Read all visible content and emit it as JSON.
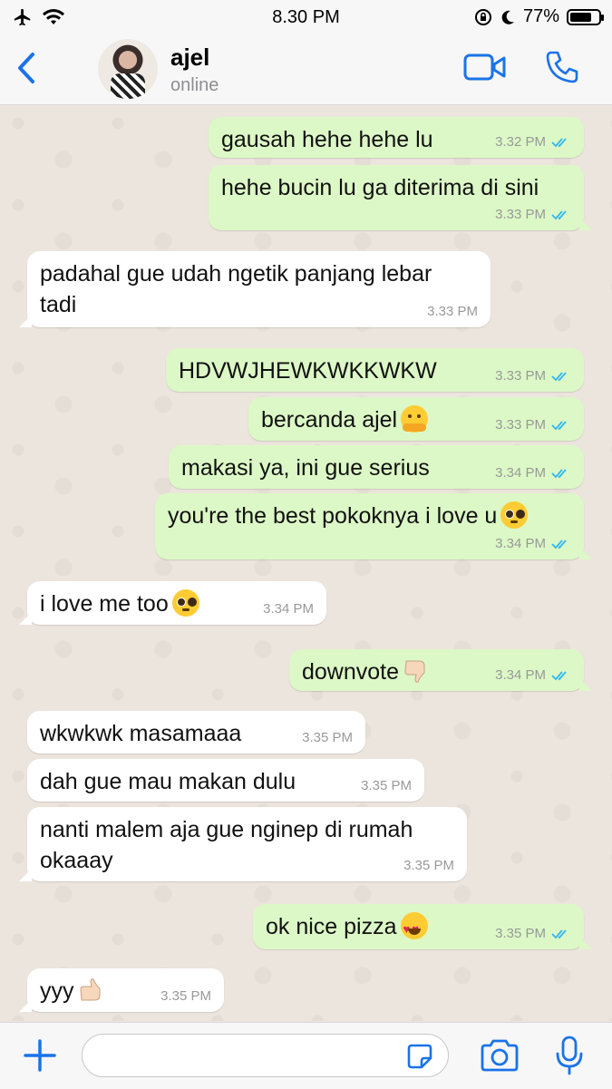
{
  "status_bar": {
    "time": "8.30 PM",
    "battery": "77%",
    "battery_level": 0.77,
    "icons": [
      "airplane-icon",
      "wifi-icon",
      "orientation-lock-icon",
      "moon-icon",
      "battery-icon"
    ]
  },
  "header": {
    "contact_name": "ajel",
    "status": "online",
    "accent": "#1a73e8"
  },
  "messages": [
    {
      "dir": "out",
      "text": "gausah hehe hehe lu",
      "time": "3.32 PM",
      "read": true
    },
    {
      "dir": "out",
      "text": "hehe bucin lu ga diterima di sini",
      "time": "3.33 PM",
      "read": true
    },
    {
      "dir": "in",
      "lines": [
        "padahal gue udah ngetik panjang lebar",
        "tadi"
      ],
      "time": "3.33 PM"
    },
    {
      "dir": "out",
      "text": "HDVWJHEWKWKKWKW",
      "time": "3.33 PM",
      "read": true
    },
    {
      "dir": "out",
      "text": "bercanda ajel",
      "emoji": "hugging-face-emoji",
      "time": "3.33 PM",
      "read": true
    },
    {
      "dir": "out",
      "text": "makasi ya, ini gue serius",
      "time": "3.34 PM",
      "read": true
    },
    {
      "dir": "out",
      "text": "you're the best pokoknya i love u",
      "emoji": "pleading-face-emoji",
      "time": "3.34 PM",
      "read": true
    },
    {
      "dir": "in",
      "text": "i love me too",
      "emoji": "pleading-face-emoji",
      "time": "3.34 PM"
    },
    {
      "dir": "out",
      "text": "downvote",
      "emoji": "thumbs-down-emoji",
      "time": "3.34 PM",
      "read": true
    },
    {
      "dir": "in",
      "text": "wkwkwk masamaaa",
      "time": "3.35 PM"
    },
    {
      "dir": "in",
      "text": "dah gue mau makan dulu",
      "time": "3.35 PM"
    },
    {
      "dir": "in",
      "lines": [
        "nanti malem aja gue nginep di rumah",
        "okaaay"
      ],
      "time": "3.35 PM"
    },
    {
      "dir": "out",
      "text": "ok nice pizza",
      "emoji": "heart-eyes-emoji",
      "time": "3.35 PM",
      "read": true
    },
    {
      "dir": "in",
      "text": "yyy",
      "emoji": "thumbs-up-emoji",
      "time": "3.35 PM"
    }
  ],
  "input": {
    "value": "",
    "placeholder": ""
  },
  "colors": {
    "outgoing_bubble": "#dcf8c6",
    "incoming_bubble": "#ffffff",
    "read_ticks": "#34b7f1",
    "chat_background": "#ece5dd"
  }
}
